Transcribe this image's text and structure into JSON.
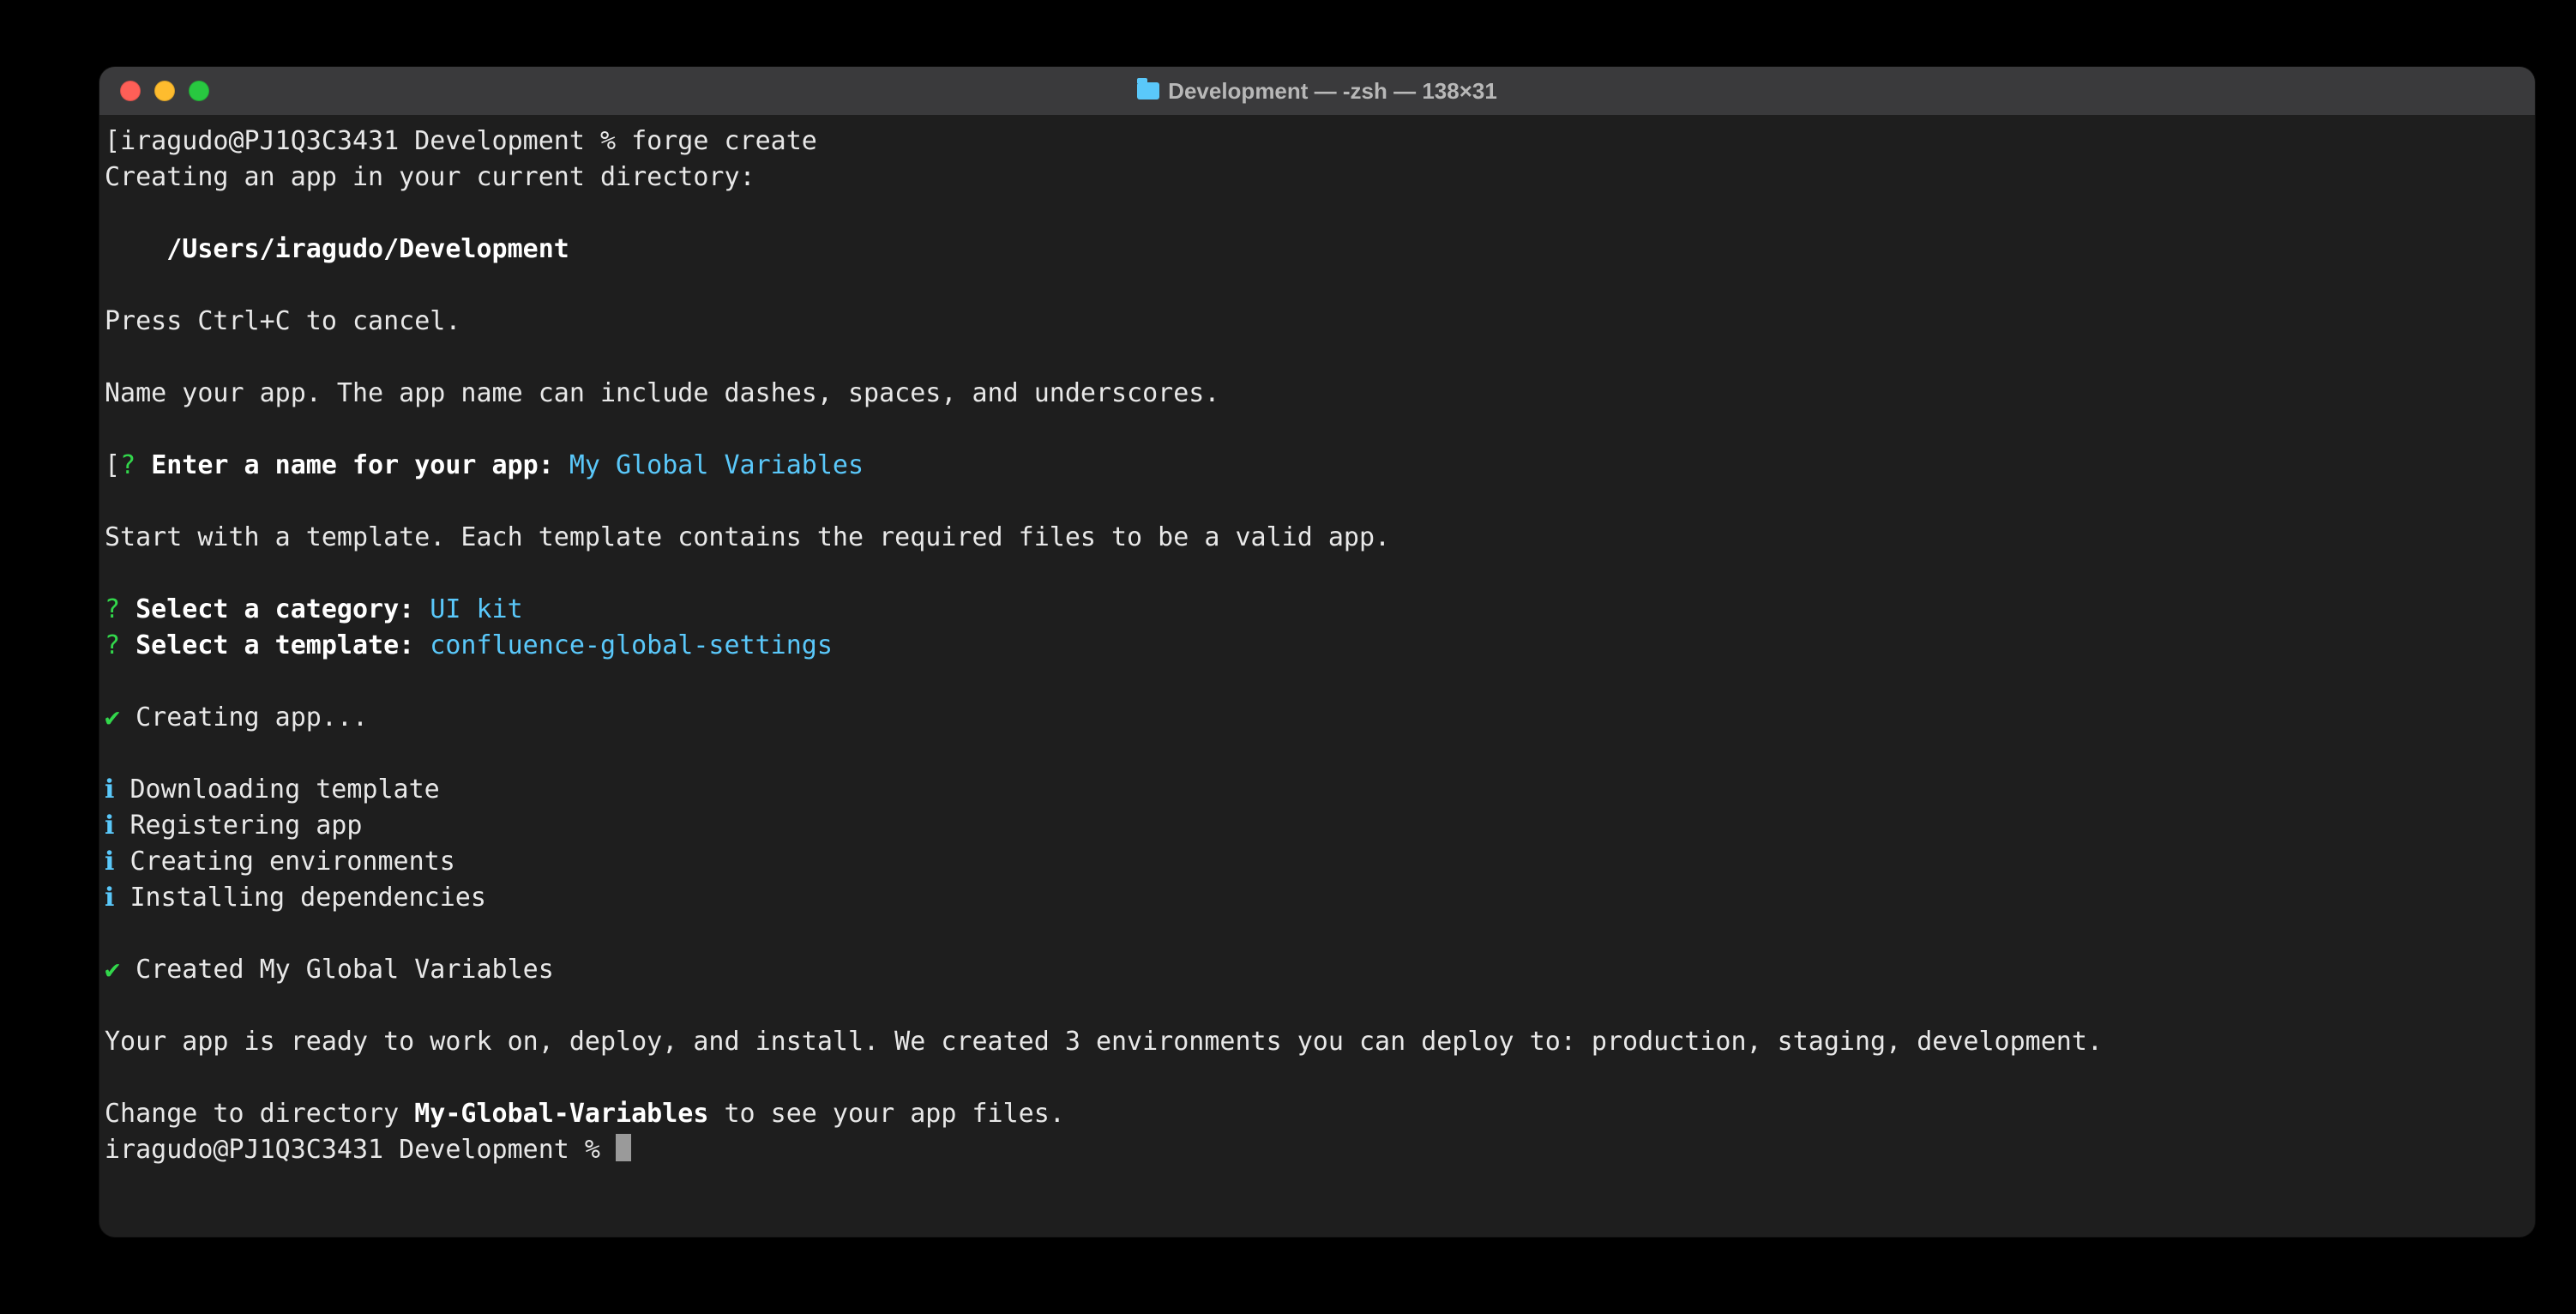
{
  "window": {
    "title": "Development — -zsh — 138×31"
  },
  "prompt": {
    "user_host": "iragudo@PJ1Q3C3431",
    "cwd": "Development",
    "symbol": "%"
  },
  "cmd": "forge create",
  "l_creating": "Creating an app in your current directory:",
  "path": "/Users/iragudo/Development",
  "l_cancel": "Press Ctrl+C to cancel.",
  "l_name_help": "Name your app. The app name can include dashes, spaces, and underscores.",
  "q_name_label": "Enter a name for your app:",
  "q_name_value": "My Global Variables",
  "l_template_help": "Start with a template. Each template contains the required files to be a valid app.",
  "q_cat_label": "Select a category:",
  "q_cat_value": "UI kit",
  "q_tpl_label": "Select a template:",
  "q_tpl_value": "confluence-global-settings",
  "step_creating": "Creating app...",
  "info1": "Downloading template",
  "info2": "Registering app",
  "info3": "Creating environments",
  "info4": "Installing dependencies",
  "created": "Created My Global Variables",
  "ready": "Your app is ready to work on, deploy, and install. We created 3 environments you can deploy to: production, staging, development.",
  "change_pre": "Change to directory ",
  "change_dir": "My-Global-Variables",
  "change_post": " to see your app files.",
  "glyphs": {
    "qmark": "?",
    "check": "✔",
    "info": "ℹ",
    "bracket": "["
  }
}
